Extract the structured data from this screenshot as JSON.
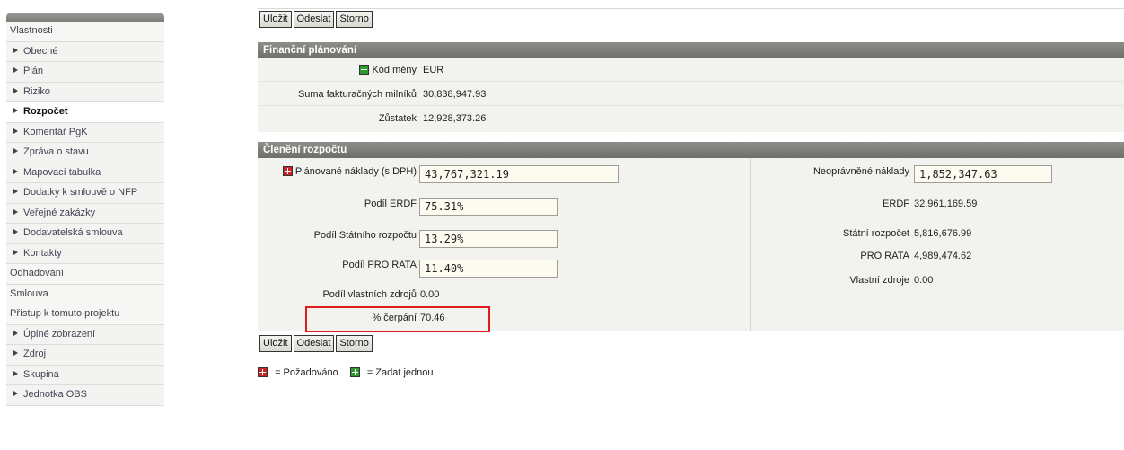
{
  "sidebar": {
    "sections": [
      {
        "label": "Vlastnosti",
        "items": [
          {
            "label": "Obecné"
          },
          {
            "label": "Plán"
          },
          {
            "label": "Riziko"
          },
          {
            "label": "Rozpočet",
            "active": true
          },
          {
            "label": "Komentář PgK"
          },
          {
            "label": "Zpráva o stavu"
          },
          {
            "label": "Mapovací tabulka"
          },
          {
            "label": "Dodatky k smlouvě o NFP"
          },
          {
            "label": "Veřejné zakázky"
          },
          {
            "label": "Dodavatelská smlouva"
          },
          {
            "label": "Kontakty"
          }
        ]
      },
      {
        "label": "Odhadování",
        "items": []
      },
      {
        "label": "Smlouva",
        "items": []
      },
      {
        "label": "Přístup k tomuto projektu",
        "items": [
          {
            "label": "Úplné zobrazení"
          },
          {
            "label": "Zdroj"
          },
          {
            "label": "Skupina"
          },
          {
            "label": "Jednotka OBS"
          }
        ]
      }
    ]
  },
  "toolbar": {
    "save": "Uložit",
    "send": "Odeslat",
    "cancel": "Storno"
  },
  "financni": {
    "title": "Finanční plánování",
    "currency_label": "Kód měny",
    "currency_value": "EUR",
    "milestones_label": "Suma fakturačných milníků",
    "milestones_value": "30,838,947.93",
    "balance_label": "Zůstatek",
    "balance_value": "12,928,373.26"
  },
  "cleneni": {
    "title": "Členění rozpočtu",
    "left": {
      "planned_label": "Plánované náklady (s DPH)",
      "planned_value": "43,767,321.19",
      "erdf_label": "Podíl ERDF",
      "erdf_value": "75.31%",
      "state_label": "Podíl Státního rozpočtu",
      "state_value": "13.29%",
      "prorata_label": "Podíl PRO RATA",
      "prorata_value": "11.40%",
      "own_label": "Podíl vlastních zdrojů",
      "own_value": "0.00",
      "draw_label": "% čerpání",
      "draw_value": "70.46"
    },
    "right": {
      "ineligible_label": "Neoprávněné náklady",
      "ineligible_value": "1,852,347.63",
      "erdf_label": "ERDF",
      "erdf_value": "32,961,169.59",
      "state_label": "Státní rozpočet",
      "state_value": "5,816,676.99",
      "prorata_label": "PRO RATA",
      "prorata_value": "4,989,474.62",
      "own_label": "Vlastní zdroje",
      "own_value": "0.00"
    }
  },
  "legend": {
    "required": "= Požadováno",
    "once": "= Zadat jednou"
  },
  "colors": {
    "required": "#cc2222",
    "once": "#2c9a2c",
    "highlight": "#e01b1b",
    "header": "#7d7d79"
  }
}
